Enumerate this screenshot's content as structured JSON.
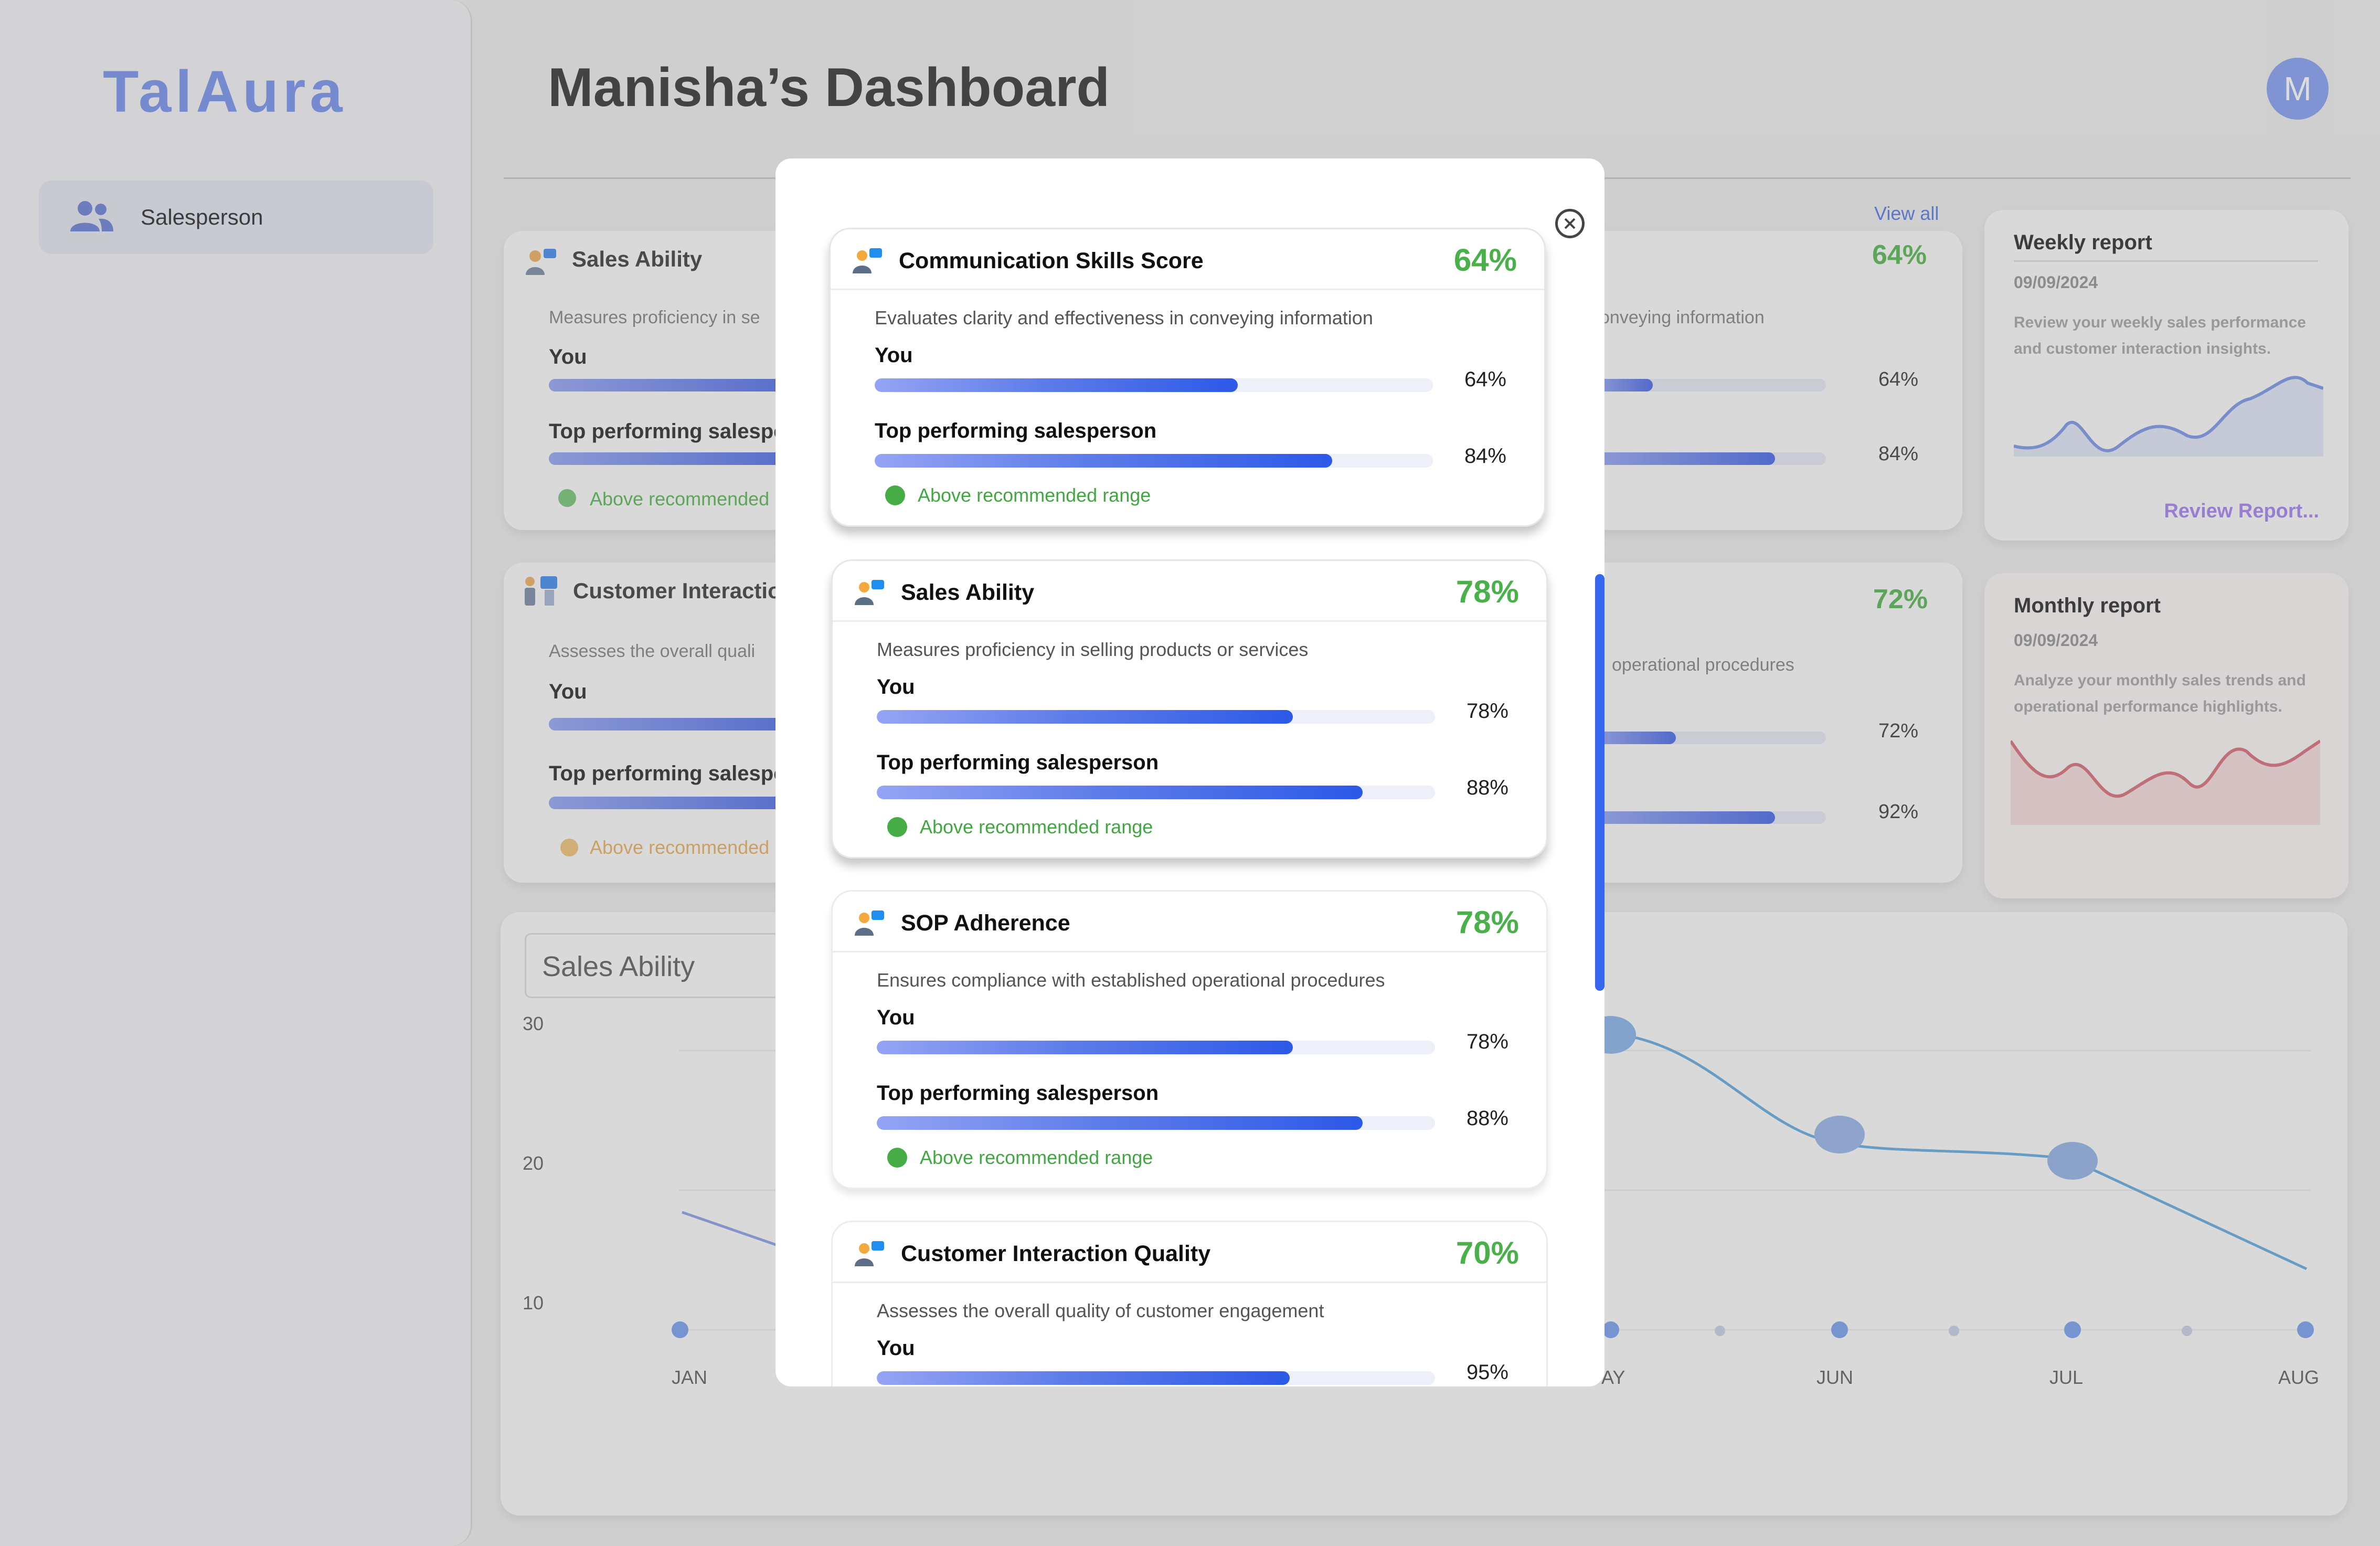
{
  "app": {
    "logo": "TalAura"
  },
  "sidebar": {
    "items": [
      {
        "label": "Salesperson",
        "icon": "users-icon"
      }
    ]
  },
  "header": {
    "title": "Manisha’s Dashboard",
    "avatar_initial": "M",
    "view_all": "View all"
  },
  "background_cards": [
    {
      "title": "Sales Ability",
      "desc": "Measures proficiency in se",
      "you_label": "You",
      "top_label": "Top performing salespe",
      "status": "Above recommended"
    },
    {
      "title": "",
      "desc": "conveying information",
      "percent": "64%",
      "you_value": "64%",
      "top_value": "84%"
    },
    {
      "title": "Customer Interaction",
      "desc": "Assesses the overall quali",
      "you_label": "You",
      "top_label": "Top performing salespe",
      "status": "Above recommended"
    },
    {
      "title": "",
      "desc": "operational procedures",
      "percent": "72%",
      "you_value": "72%",
      "top_value": "92%"
    }
  ],
  "reports": [
    {
      "title": "Weekly report",
      "date": "09/09/2024",
      "text": "Review your weekly sales performance and customer interaction insights.",
      "link": "Review Report..."
    },
    {
      "title": "Monthly report",
      "date": "09/09/2024",
      "text": "Analyze your monthly sales trends and operational performance highlights."
    }
  ],
  "chart_panel": {
    "select_value": "Sales Ability",
    "y_ticks": [
      "30",
      "20",
      "10"
    ],
    "x_ticks": [
      "JAN",
      "AY",
      "JUN",
      "JUL",
      "AUG"
    ]
  },
  "modal": {
    "cards": [
      {
        "title": "Communication Skills Score",
        "percent": "64%",
        "desc": "Evaluates clarity and effectiveness in conveying information",
        "you_label": "You",
        "you_value": "64%",
        "you_fill": 0.65,
        "top_label": "Top performing salesperson",
        "top_value": "84%",
        "top_fill": 0.82,
        "status": "Above recommended range"
      },
      {
        "title": "Sales Ability",
        "percent": "78%",
        "desc": "Measures proficiency in selling products or services",
        "you_label": "You",
        "you_value": "78%",
        "you_fill": 0.745,
        "top_label": "Top performing salesperson",
        "top_value": "88%",
        "top_fill": 0.87,
        "status": "Above recommended range"
      },
      {
        "title": "SOP Adherence",
        "percent": "78%",
        "desc": "Ensures compliance with established operational procedures",
        "you_label": "You",
        "you_value": "78%",
        "you_fill": 0.745,
        "top_label": "Top performing salesperson",
        "top_value": "88%",
        "top_fill": 0.87,
        "status": "Above recommended range"
      },
      {
        "title": "Customer Interaction Quality",
        "percent": "70%",
        "desc": "Assesses the overall quality of customer engagement",
        "you_label": "You",
        "you_value": "95%",
        "you_fill": 0.74
      }
    ]
  },
  "colors": {
    "accent": "#3566f0",
    "success": "#4ab04a",
    "logo": "#7d97f0"
  }
}
